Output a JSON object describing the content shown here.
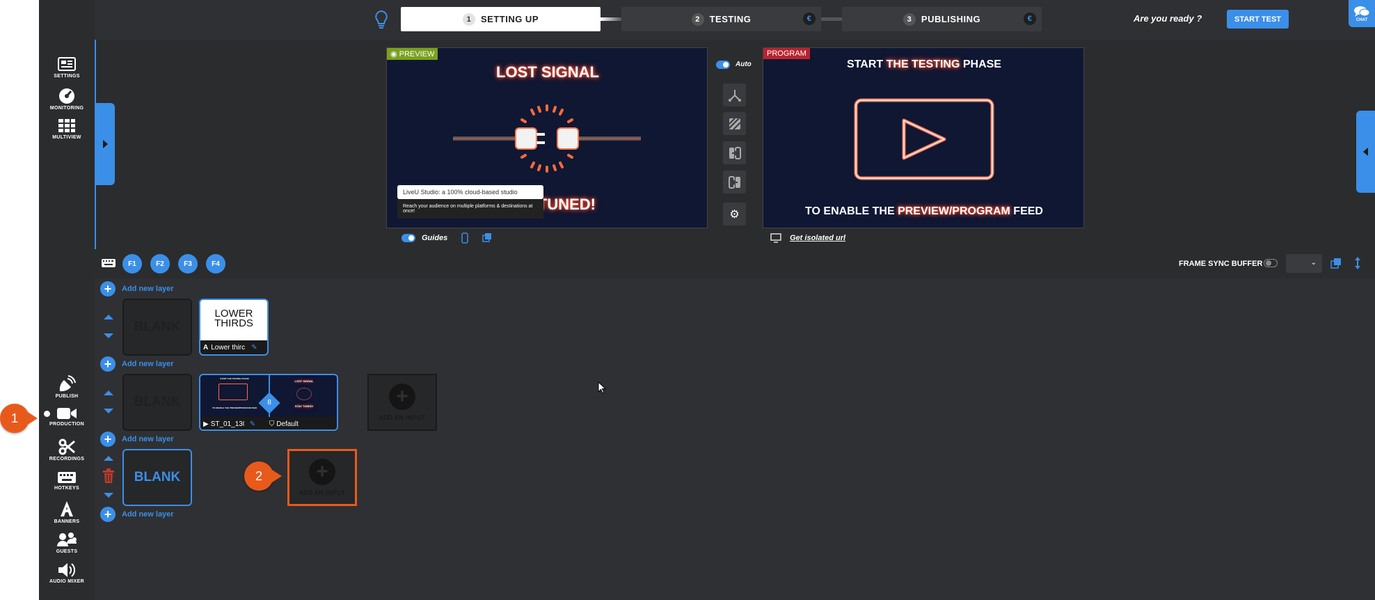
{
  "steps": [
    {
      "num": "1",
      "label": "SETTING UP"
    },
    {
      "num": "2",
      "label": "TESTING"
    },
    {
      "num": "3",
      "label": "PUBLISHING"
    }
  ],
  "euro_symbol": "€",
  "header": {
    "ready_text": "Are you ready ?",
    "start_test": "START TEST",
    "chat": "CHAT"
  },
  "sidebar": {
    "top": [
      {
        "label": "SETTINGS",
        "icon": "settings-icon"
      },
      {
        "label": "MONITORING",
        "icon": "monitoring-icon"
      },
      {
        "label": "MULTIVIEW",
        "icon": "multiview-icon"
      }
    ],
    "bottom": [
      {
        "label": "PUBLISH",
        "icon": "publish-icon"
      },
      {
        "label": "PRODUCTION",
        "icon": "production-icon"
      },
      {
        "label": "RECORDINGS",
        "icon": "recordings-icon"
      },
      {
        "label": "HOTKEYS",
        "icon": "hotkeys-icon"
      },
      {
        "label": "BANNERS",
        "icon": "banners-icon"
      },
      {
        "label": "GUESTS",
        "icon": "guests-icon"
      },
      {
        "label": "AUDIO MIXER",
        "icon": "audio-mixer-icon"
      }
    ]
  },
  "preview": {
    "tag": "PREVIEW",
    "title": "LOST SIGNAL",
    "bottom_text": "TUNED!",
    "tooltip_title": "LiveU Studio: a 100% cloud-based studio",
    "tooltip_sub": "Reach your audience on multiple platforms & destinations at once!"
  },
  "program": {
    "tag": "PROGRAM",
    "line1_a": "START ",
    "line1_b": "THE TESTING",
    "line1_c": " PHASE",
    "line2_a": "TO ENABLE THE ",
    "line2_b": "PREVIEW/PROGRAM",
    "line2_c": " FEED",
    "isolated_link": "Get isolated url"
  },
  "controls": {
    "auto_label": "Auto",
    "guides_label": "Guides"
  },
  "fkeys": [
    "F1",
    "F2",
    "F3",
    "F4"
  ],
  "frame_sync": {
    "label": "FRAME SYNC BUFFER",
    "value": ""
  },
  "add_layer_label": "Add new layer",
  "layers": {
    "blank_label": "BLANK",
    "lower_thirds": {
      "title_line1": "LOWER",
      "title_line2": "THIRDS",
      "caption": "Lower thirc"
    },
    "scene_card": {
      "left_caption": "ST_01_130",
      "right_caption": "Default",
      "badge": "8"
    },
    "add_input_label": "ADD AN INPUT"
  },
  "scene_thumb": {
    "left_line1": "START THE TESTING PHASE",
    "left_line2": "TO ENABLE THE PREVIEW/PROGRAM FEED",
    "right_line1": "LOST SIGNAL",
    "right_line2": "STAY TUNED!"
  },
  "callouts": [
    "1",
    "2"
  ],
  "colors": {
    "accent": "#3b8fe8",
    "callout": "#e85a1b",
    "preview_tag": "#7aa11e",
    "program_tag": "#b8232f",
    "neon": "#ff5a3c"
  }
}
